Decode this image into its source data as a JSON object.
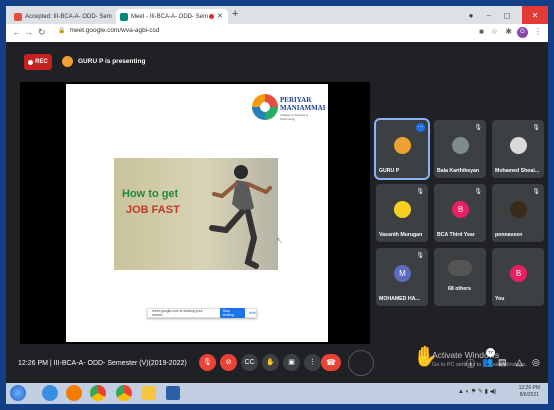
{
  "browser": {
    "tabs": [
      {
        "title": "Accepted: III-BCA-A- ODD- Sem"
      },
      {
        "title": "Meet - III-BCA-A- ODD- Sem"
      }
    ],
    "url": "meet.google.com/wva-agbi-csd",
    "profile_initial": "G"
  },
  "meet": {
    "rec_label": "REC",
    "presenting_label": "GURU P is presenting",
    "slide": {
      "logo_name_line1": "PERIYAR",
      "logo_name_line2": "MANIAMMAI",
      "logo_sub": "Institute of Science & Technology",
      "headline_line1": "How to get",
      "headline_line2": "JOB FAST",
      "share_text": "meet.google.com is sharing your screen.",
      "stop_sharing": "Stop sharing",
      "hide": "Hide"
    },
    "participants": [
      {
        "name": "GURU P",
        "avatar": ""
      },
      {
        "name": "Bala Karthikeyan",
        "avatar": ""
      },
      {
        "name": "Mohamed Shoai...",
        "avatar": ""
      },
      {
        "name": "Vasanth Murugan",
        "avatar": ""
      },
      {
        "name": "BCA Third Year",
        "avatar": "B"
      },
      {
        "name": "ponnaveen",
        "avatar": ""
      },
      {
        "name": "MOHAMED HA...",
        "avatar": "M"
      },
      {
        "name": "68 others",
        "avatar": ""
      },
      {
        "name": "You",
        "avatar": "B"
      }
    ],
    "meeting_info": "12:26 PM  |  III-BCA-A- ODD- Semester (V)(2019-2022)",
    "chat_count": "77",
    "activate_line1": "Activate Windows",
    "activate_line2": "Go to PC settings to activate Windows."
  },
  "taskbar": {
    "time": "12:26 PM",
    "date": "8/6/2021"
  }
}
